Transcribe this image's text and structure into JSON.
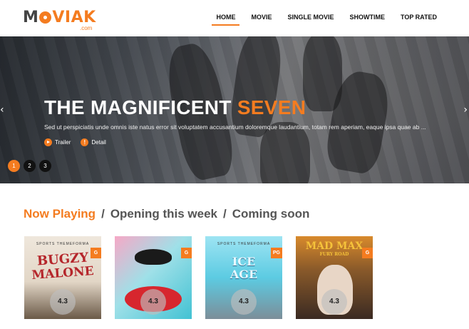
{
  "header": {
    "logo": {
      "text_before": "M",
      "text_after": "VIAK",
      "subtext": ".com"
    },
    "nav": [
      {
        "label": "HOME",
        "active": true
      },
      {
        "label": "MOVIE",
        "active": false
      },
      {
        "label": "SINGLE MOVIE",
        "active": false
      },
      {
        "label": "SHOWTIME",
        "active": false
      },
      {
        "label": "TOP RATED",
        "active": false
      }
    ]
  },
  "hero": {
    "title_main": "THE MAGNIFICENT",
    "title_accent": "SEVEN",
    "description": "Sed ut perspiciatis unde omnis iste natus error sit voluptatem accusantium doloremque laudantium, totam rem aperiam, eaque ipsa quae ab ...",
    "trailer_label": "Trailer",
    "detail_label": "Detail",
    "pages": [
      "1",
      "2",
      "3"
    ],
    "active_page": "1",
    "prev_arrow": "‹",
    "next_arrow": "›"
  },
  "tabs": {
    "now_playing": "Now Playing",
    "separator": "/",
    "opening": "Opening this week",
    "coming": "Coming soon"
  },
  "movies": [
    {
      "art_text_1": "BUGZY",
      "art_text_2": "MALONE",
      "tagline": "SPORTS THEMEFORMA",
      "badge": "G",
      "rating": "4.3"
    },
    {
      "art_text_1": "",
      "art_text_2": "",
      "tagline": "",
      "badge": "G",
      "rating": "4.3"
    },
    {
      "art_text_1": "ICE",
      "art_text_2": "AGE",
      "tagline": "SPORTS THEMEFORMA",
      "badge": "PG",
      "rating": "4.3"
    },
    {
      "art_text_1": "MAD MAX",
      "art_text_2": "FURY ROAD",
      "tagline": "",
      "badge": "G",
      "rating": "4.3"
    }
  ],
  "colors": {
    "accent": "#f47c20",
    "text_dark": "#111111",
    "tab_gray": "#555555"
  }
}
